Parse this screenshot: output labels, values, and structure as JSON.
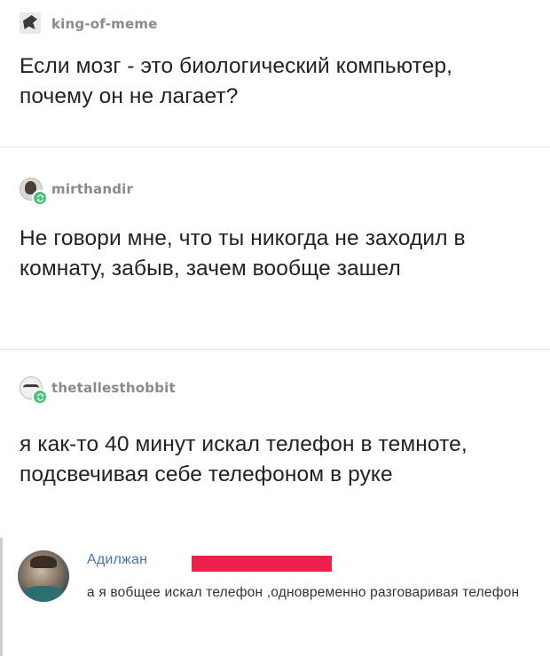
{
  "posts": [
    {
      "username": "king-of-meme",
      "avatar_icon": "meme-figure-icon",
      "text": "Если мозг - это биологический компьютер, почему он не лагает?"
    },
    {
      "username": "mirthandir",
      "avatar_icon": "user-avatar-icon",
      "reblog_icon": "reblog-icon",
      "text": "Не говори мне, что ты никогда не заходил в комнату, забыв, зачем вообще зашел"
    },
    {
      "username": "thetallesthobbit",
      "avatar_icon": "user-avatar-icon",
      "reblog_icon": "reblog-icon",
      "text": "я как-то 40 минут искал телефон в темноте, подсвечивая себе телефоном в руке"
    }
  ],
  "comment": {
    "author": "Адилжан",
    "redaction_color": "#ee1f4a",
    "text": "а я вобщее искал телефон ,одновременно разговаривая телефон"
  },
  "colors": {
    "username": "#8a8a8a",
    "reblog_badge": "#4fbf7a",
    "comment_author": "#4a74a6"
  }
}
